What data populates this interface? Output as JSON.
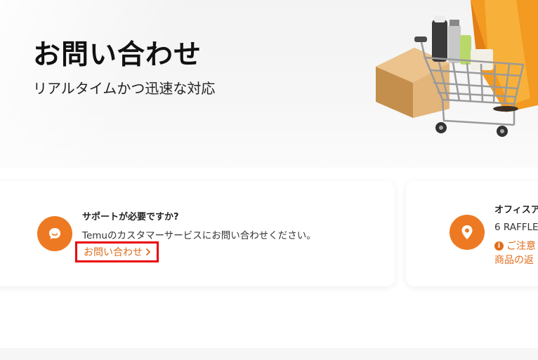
{
  "hero": {
    "title": "お問い合わせ",
    "subtitle": "リアルタイムかつ迅速な対応"
  },
  "support_card": {
    "icon": "chat-bubble-icon",
    "title": "サポートが必要ですか?",
    "description": "Temuのカスタマーサービスにお問い合わせください。",
    "link_label": "お問い合わせ"
  },
  "office_card": {
    "icon": "location-pin-icon",
    "title": "オフィスア",
    "address": "6 RAFFLE",
    "notice_line1": "ご注意",
    "notice_line2": "商品の返"
  },
  "colors": {
    "accent": "#ed7a22",
    "link": "#e06c19",
    "highlight_box": "#e8000b"
  }
}
